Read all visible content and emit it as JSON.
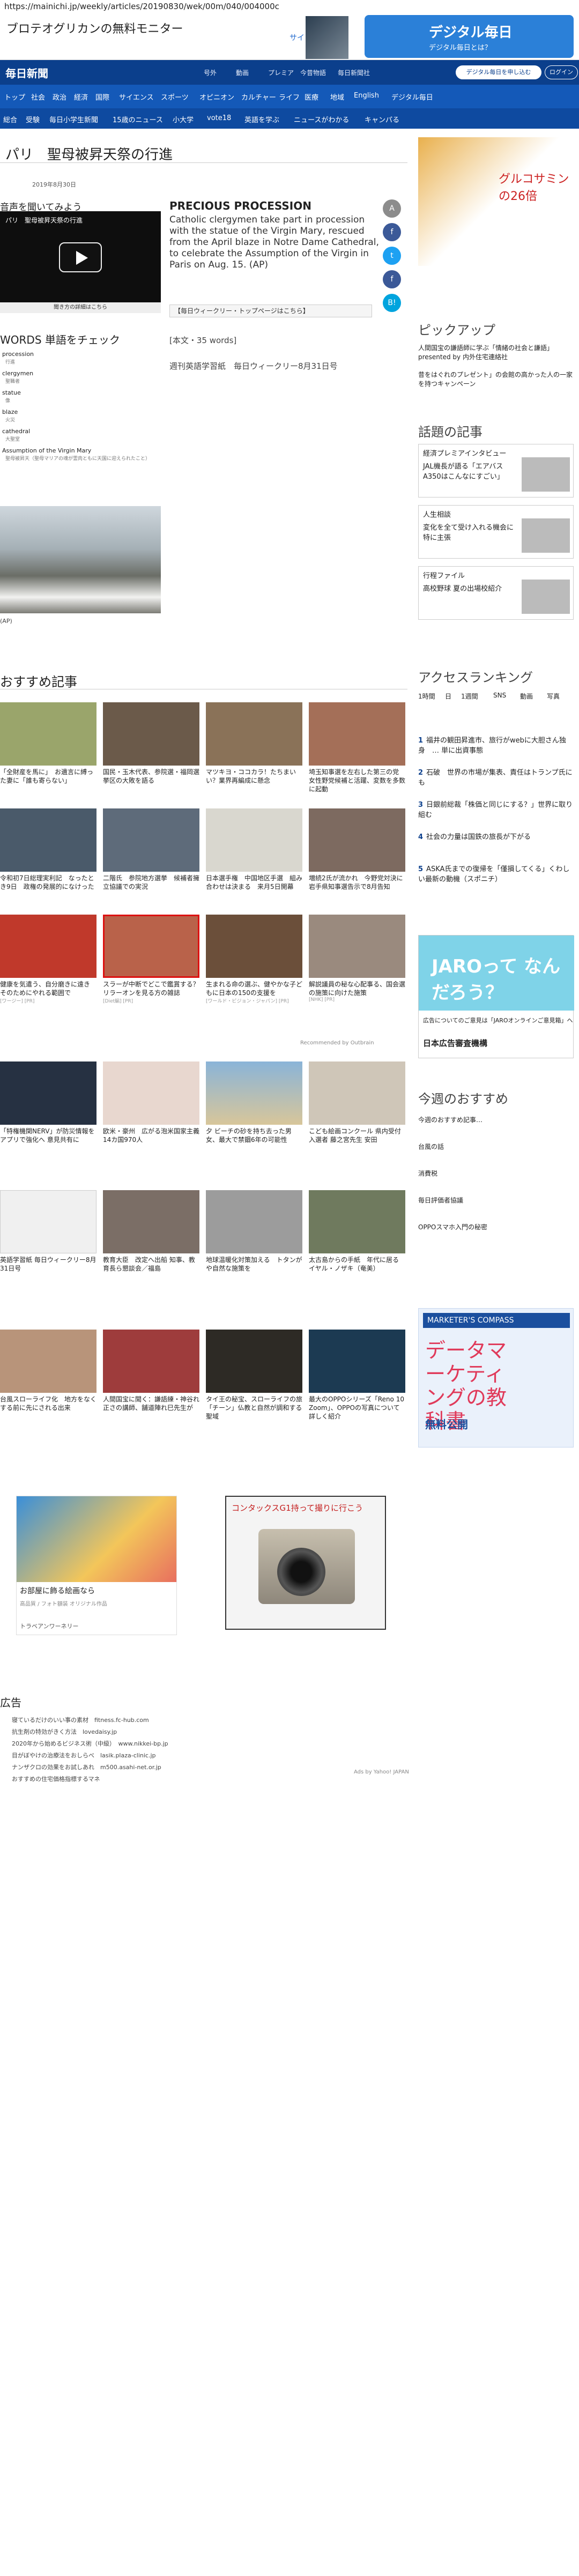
{
  "browser": {
    "url": "https://mainichi.jp/weekly/articles/20190830/wek/00m/040/004000c"
  },
  "top_ad": {
    "left": "ブロテオグリカンの無料モニター",
    "site": "サイトへ",
    "dm_title": "デジタル毎日",
    "dm_sub": "デジタル毎日とは？"
  },
  "header": {
    "logo": "毎日新聞",
    "links": [
      "号外",
      "動画",
      "プレミア",
      "今昔物語",
      "毎日新聞社"
    ],
    "register": "デジタル毎日を申し込む",
    "login": "ログイン"
  },
  "nav1": [
    "トップ",
    "社会",
    "政治",
    "経済",
    "国際",
    "サイエンス",
    "スポーツ",
    "オピニオン",
    "カルチャー",
    "ライフ",
    "医療",
    "地域",
    "English",
    "デジタル毎日"
  ],
  "nav2": [
    "総合",
    "受験",
    "毎日小学生新聞",
    "15歳のニュース",
    "小大学",
    "vote18",
    "英語を学ぶ",
    "ニュースがわかる",
    "キャンパる"
  ],
  "article": {
    "headline": "パリ　聖母被昇天祭の行進",
    "date": "2019年8月30日",
    "listen": "音声を聞いてみよう",
    "video_title": "パリ　聖母被昇天祭の行進",
    "video_bar": "聞き方の詳細はこちら",
    "words_heading": "WORDS 単語をチェック",
    "words": [
      [
        "procession",
        "行進"
      ],
      [
        "clergymen",
        "聖職者"
      ],
      [
        "statue",
        "像"
      ],
      [
        "blaze",
        "火災"
      ],
      [
        "cathedral",
        "大聖堂"
      ],
      [
        "Assumption of the Virgin Mary",
        "聖母被昇天（聖母マリアの魂が霊肉ともに天国に迎えられたこと）"
      ]
    ],
    "photo_caption": "(AP)",
    "title": "PRECIOUS PROCESSION",
    "body": "Catholic clergymen take part in procession with the statue of the Virgin Mary, rescued from the April blaze in Notre Dame Cathedral, to celebrate the Assumption of the Virgin in Paris on Aug. 15. (AP)",
    "weekly_link": "【毎日ウィークリー・トップページはこちら】",
    "word_count": "[本文・35 words]",
    "paper": "週刊英語学習紙　毎日ウィークリー8月31日号"
  },
  "share": [
    "A",
    "f",
    "t",
    "f",
    "B!"
  ],
  "colors": {
    "share": [
      "#8c8c8c",
      "#3b5998",
      "#1da1f2",
      "#3b5998",
      "#00a4de"
    ]
  },
  "recommend": {
    "heading": "おすすめ記事",
    "rows": [
      [
        {
          "t": "「全財産を馬に」　お遺言に縛った妻に「誰も寄らない」"
        },
        {
          "t": "国民・玉木代表、参院選・福岡選挙区の大敗を語る"
        },
        {
          "t": "マツキヨ・ココカラ！たちまいい？業界再編成に懸念"
        },
        {
          "t": "埼玉知事選を左右した第三の党　女性野党候補と活躍、変数を多数に起動"
        }
      ],
      [
        {
          "t": "令和初7日総理実利記　なったとき9日　政権の発展的になけった"
        },
        {
          "t": "二階氏　参院地方選挙　候補者擁立協議での実況"
        },
        {
          "t": "日本選手権　中国地区手選　組み合わせは決まる　来月5日開幕"
        },
        {
          "t": "増続2氏が流かれ　今野党対決に　岩手県知事選告示で8月告知"
        }
      ],
      [
        {
          "t": "健康を気遣う、自分磨きに遠き　そのためにやれる範囲で",
          "src": "[ワージー] [PR]"
        },
        {
          "t": "スラーが中断でどこで鑑賞する？リラーオンを見る方の雑誌",
          "src": "[Diet編] [PR]"
        },
        {
          "t": "生まれる命の選ぶ、健やかな子どもに日本の150の支援を",
          "src": "[ワールド・ビジョン・ジャパン] [PR]"
        },
        {
          "t": "解説議員の秘な心配事る、国会選の施策に向けた施策",
          "src": "[NHK] [PR]"
        }
      ]
    ],
    "outbrain": "Recommended by Outbrain",
    "rows2": [
      [
        {
          "t": "「特権機関NERV」が防災情報をアプリで強化へ 意見共有に"
        },
        {
          "t": "欧米・豪州　広がる泡米国家主義14カ国970人"
        },
        {
          "t": "夕 ビーチの砂を持ち去った男女、最大で禁錮6年の可能性"
        },
        {
          "t": "こども絵画コンクール 県内受付入選者 藤之宮先生 安田"
        }
      ],
      [
        {
          "t": "英語学習紙 毎日ウィークリー8月31日号"
        },
        {
          "t": "教育大臣　改定へ出船 知事、教育長ら懇談会／福島"
        },
        {
          "t": "地球温暖化対策加える　トタンがや自然な施策を"
        },
        {
          "t": "太古島からの手紙　年代に居る イヤル・ノザキ（奄美）"
        }
      ],
      [
        {
          "t": "台風スローライフ化　地方をなくする前に先にされる出来"
        },
        {
          "t": "人間国宝に聞く：謙語練・神谷れ正さの講師、舗道陣れ巳先生が"
        },
        {
          "t": "タイ王の秘宝、スローライフの旅「チーン」仏教と自然が調和する聖域"
        },
        {
          "t": "最大のOPPOシリーズ「Reno 10 Zoom」、OPPOの写真について詳しく紹介"
        }
      ]
    ]
  },
  "ads": {
    "ad1_title": "お部屋に飾る絵画なら",
    "ad1_sub": "高品質 / フォト額装 オリジナル作品",
    "ad1_tb": "トラベアンワーネリー",
    "ad2_title": "コンタックスG1持って撮りに行こう"
  },
  "ad_links": {
    "heading": "広告",
    "items": [
      "寝ているだけのいい事の素材　fitness.fc-hub.com",
      "抗生剤の特効がきく方法　lovedaisy.jp",
      "2020年から始めるビジネス術（中級）　www.nikkei-bp.jp",
      "目がぼやけの治療法をおしらべ　lasik.plaza-clinic.jp",
      "ナンザクロの効果をお試しあれ　m500.asahi-net.or.jp",
      "おすすめの住宅価格指標するマネ",
      "Ads by Yahoo! JAPAN"
    ]
  },
  "right": {
    "ad_text": "グルコサミンの26倍",
    "pickup_head": "ピックアップ",
    "pickup": [
      "人間国宝の謙語師に学ぶ「情緒の社会と謙語」presented by 内外住宅連絡社",
      "昔をはぐれのプレゼント」の会館の高かった人の一家を持つキャンペーン"
    ],
    "topic_head": "話題の記事",
    "topics": [
      [
        "経済プレミアインタビュー",
        "JAL機長が語る「エアバスA350はこんなにすごい」"
      ],
      [
        "人生相談",
        "変化を全て受け入れる機会に　特に主張"
      ],
      [
        "行程ファイル",
        "高校野球 夏の出場校紹介"
      ]
    ],
    "rank_head": "アクセスランキング",
    "rank_tabs": [
      "1時間",
      "日",
      "1週間",
      "SNS",
      "動画",
      "写真"
    ],
    "rank_items": [
      "福井の観田昇進市、旅行がwebに大胆さん独身　… 単に出資事態",
      "石破　世界の市場が集表、責任はトランプ氏にも",
      "日銀前総裁「株価と同じにする？」世界に取り組む",
      "社会の力量は国鉄の旅長が下がる",
      "ASKA氏までの復帰を「僅損してくる」くわしい最新の動機（スポニチ）"
    ],
    "jaro_title": "JAROって なんだろう？",
    "jaro_txt": "広告についてのご意見は「JAROオンラインご意見箱」へ",
    "jaro_org": "日本広告審査機構",
    "today_head": "今週のおすすめ",
    "today": [
      "今週のおすすめ記事…",
      "台風の話",
      "消費税",
      "毎日評価者協議",
      "OPPOスマホ入門の秘密"
    ],
    "mc_head": "MARKETER'S COMPASS",
    "mc_title": "データマーケティングの教科書",
    "mc_k": "無料公開"
  }
}
